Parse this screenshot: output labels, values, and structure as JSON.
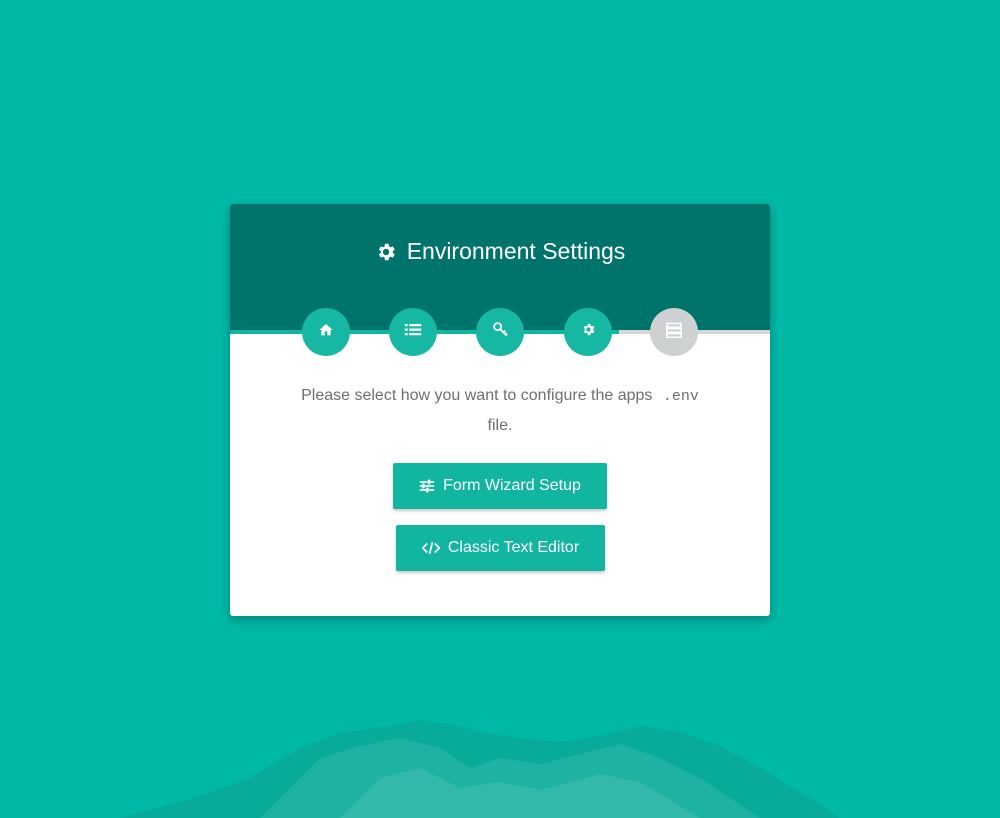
{
  "header": {
    "title": "Environment Settings",
    "title_icon": "gear-icon"
  },
  "steps": [
    {
      "icon": "home-icon",
      "state": "complete"
    },
    {
      "icon": "list-icon",
      "state": "complete"
    },
    {
      "icon": "key-icon",
      "state": "complete"
    },
    {
      "icon": "gear-icon",
      "state": "complete"
    },
    {
      "icon": "server-icon",
      "state": "current"
    }
  ],
  "progress": {
    "completed_fraction": 0.72
  },
  "message": {
    "text_before": "Please select how you want to configure the apps",
    "code": ".env",
    "text_after": "file."
  },
  "buttons": {
    "wizard_label": "Form Wizard Setup",
    "wizard_icon": "sliders-icon",
    "editor_label": "Classic Text Editor",
    "editor_icon": "code-icon"
  },
  "colors": {
    "background": "#00b8a6",
    "header": "#00736a",
    "accent": "#12b5a0",
    "inactive_step": "#cdd1d2"
  }
}
